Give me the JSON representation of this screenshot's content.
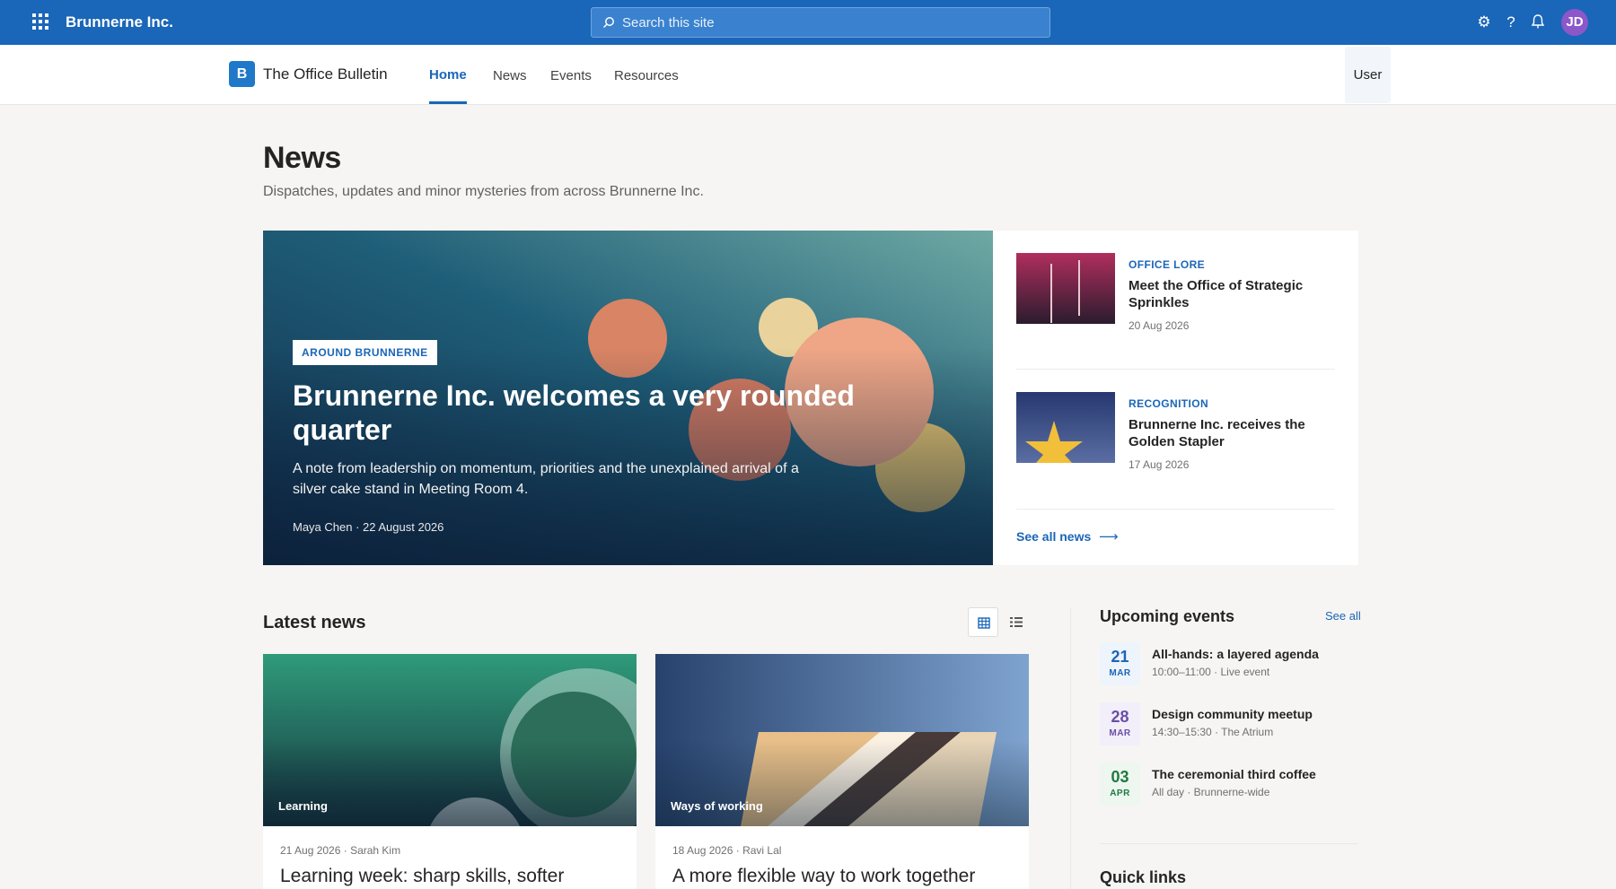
{
  "suitebar": {
    "org_name": "Brunnerne Inc.",
    "search_placeholder": "Search this site",
    "avatar_initials": "JD",
    "icons": [
      "waffle-icon",
      "search-icon",
      "gear-icon",
      "help-icon",
      "notification-icon"
    ]
  },
  "site": {
    "logo_letter": "B",
    "title": "The Office Bulletin",
    "nav": [
      {
        "label": "Home",
        "active": true
      },
      {
        "label": "News",
        "active": false
      },
      {
        "label": "Events",
        "active": false
      },
      {
        "label": "Resources",
        "active": false
      }
    ],
    "user_label": "User"
  },
  "page": {
    "title": "News",
    "subtitle": "Dispatches, updates and minor mysteries from across Brunnerne Inc."
  },
  "hero": {
    "tag": "AROUND BRUNNERNE",
    "title": "Brunnerne Inc. welcomes a very rounded quarter",
    "description": "A note from leadership on momentum, priorities and the unexplained arrival of a silver cake stand in Meeting Room 4.",
    "meta": "Maya Chen · 22 August 2026"
  },
  "side_news": {
    "items": [
      {
        "category": "OFFICE LORE",
        "title": "Meet the Office of Strategic Sprinkles",
        "date": "20 Aug 2026"
      },
      {
        "category": "RECOGNITION",
        "title": "Brunnerne Inc. receives the Golden Stapler",
        "date": "17 Aug 2026"
      }
    ],
    "see_all": "See all news"
  },
  "latest": {
    "title": "Latest news",
    "cards": [
      {
        "tag": "Learning",
        "meta": "21 Aug 2026 · Sarah Kim",
        "title": "Learning week: sharp skills, softer"
      },
      {
        "tag": "Ways of working",
        "meta": "18 Aug 2026 · Ravi Lal",
        "title": "A more flexible way to work together"
      }
    ]
  },
  "events": {
    "title": "Upcoming events",
    "see_all": "See all",
    "items": [
      {
        "day": "21",
        "month": "MAR",
        "title": "All-hands: a layered agenda",
        "sub": "10:00–11:00 · Live event",
        "color": "#1a66b8"
      },
      {
        "day": "28",
        "month": "MAR",
        "title": "Design community meetup",
        "sub": "14:30–15:30 · The Atrium",
        "color": "#6b4fa6"
      },
      {
        "day": "03",
        "month": "APR",
        "title": "The ceremonial third coffee",
        "sub": "All day · Brunnerne-wide",
        "color": "#1f7a3f"
      }
    ]
  },
  "quick_links": {
    "title": "Quick links"
  },
  "colors": {
    "accent": "#1a66b8",
    "suitebar": "#1a66b8",
    "avatar": "#8b57c9"
  }
}
